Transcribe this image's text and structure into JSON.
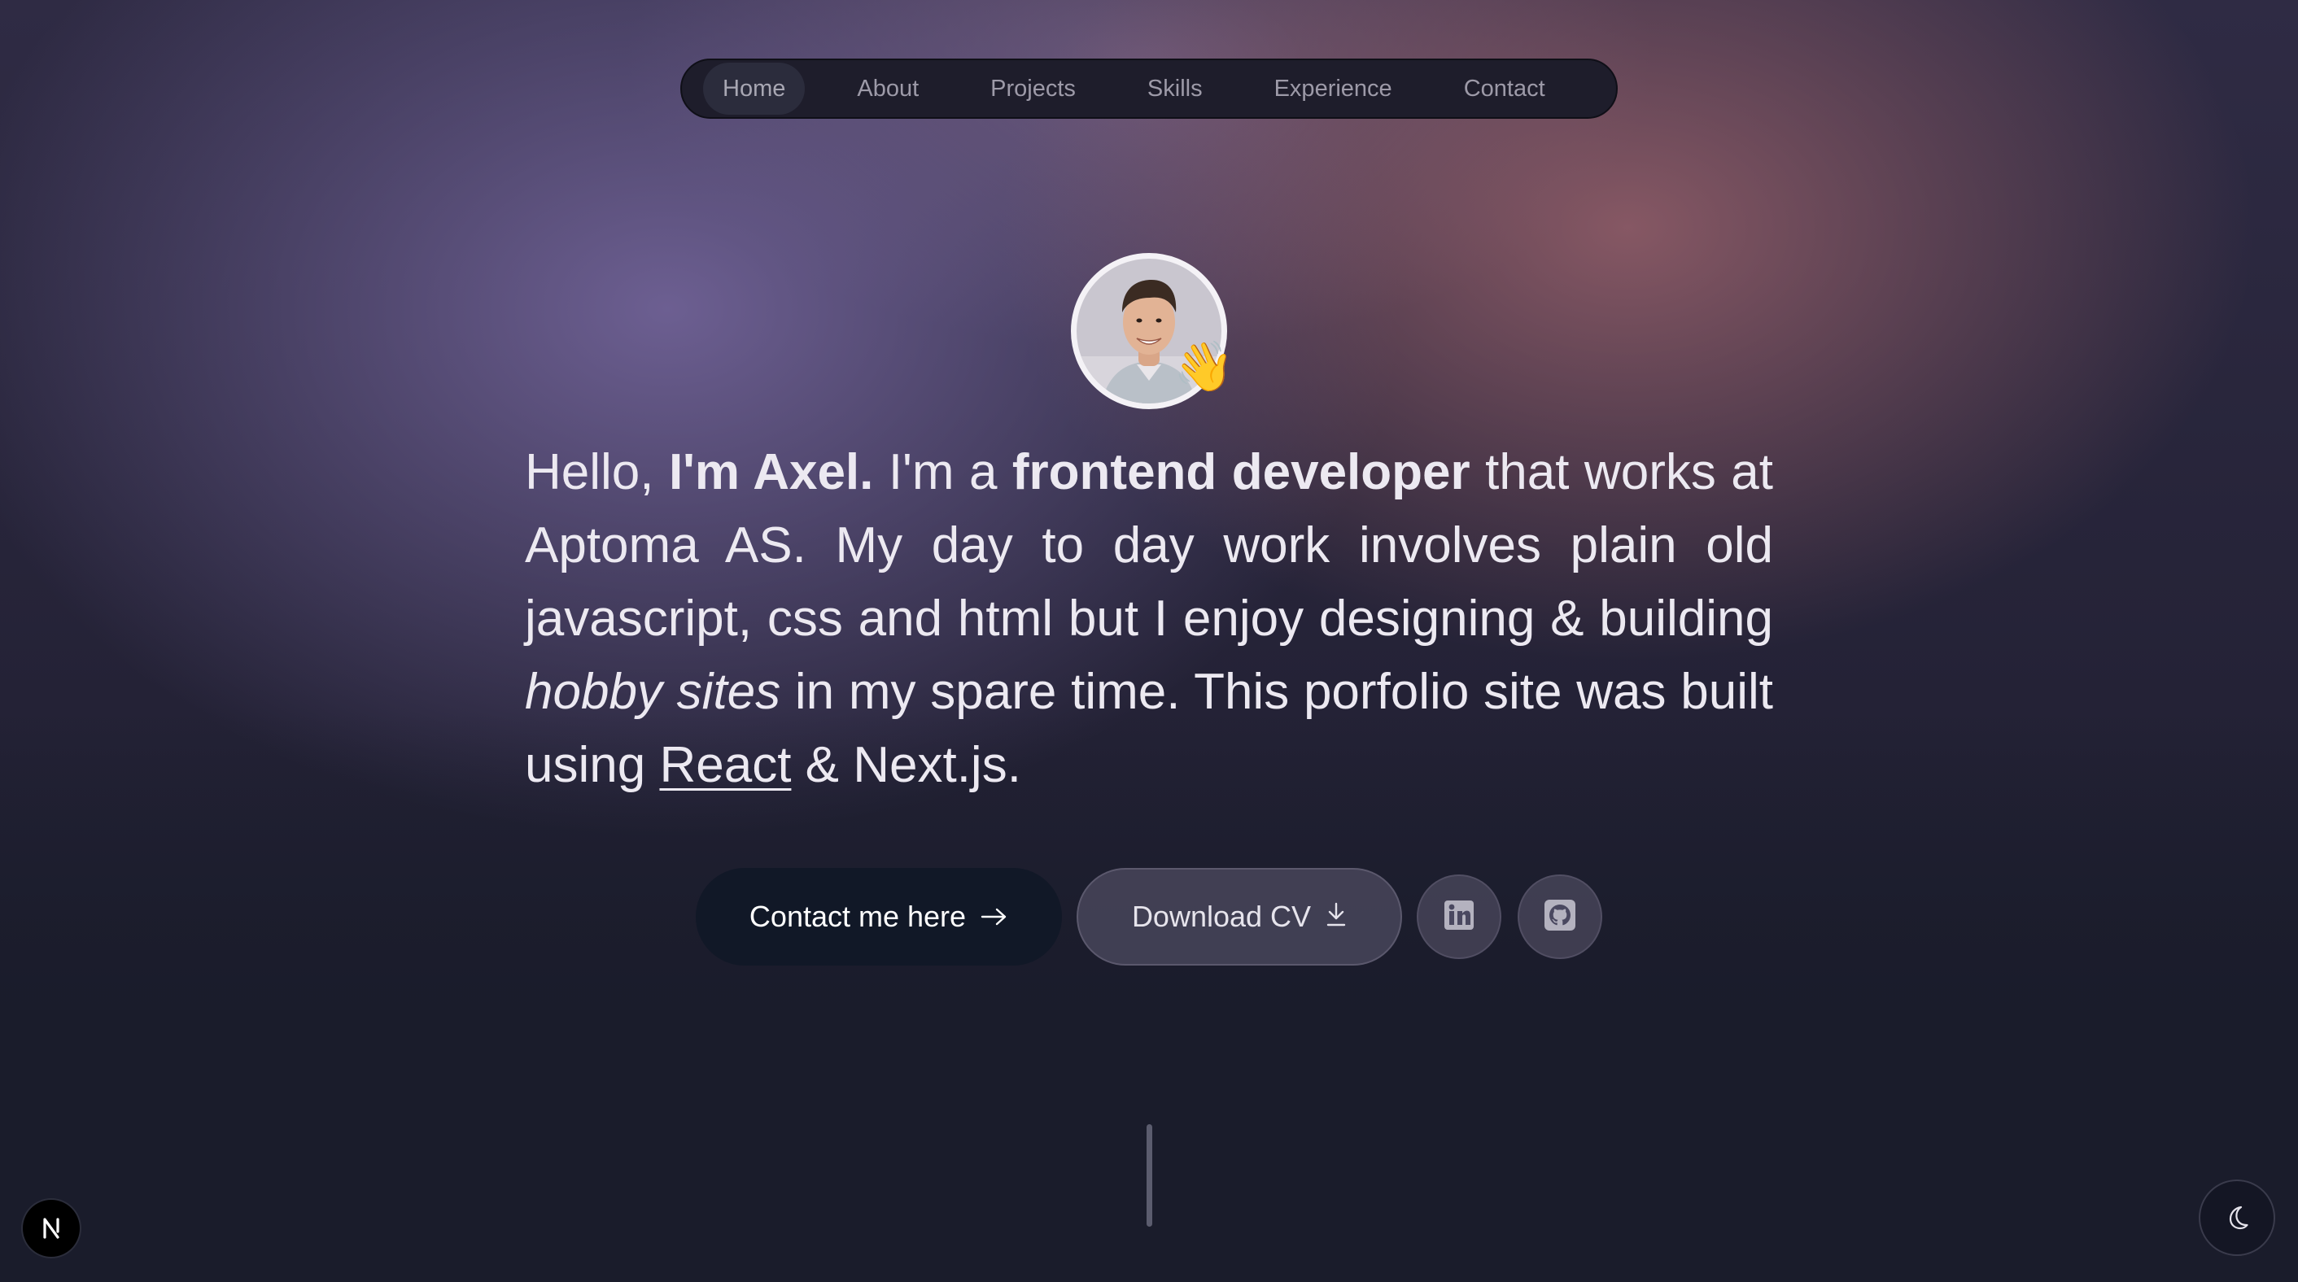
{
  "nav": {
    "items": [
      {
        "label": "Home",
        "active": true
      },
      {
        "label": "About",
        "active": false
      },
      {
        "label": "Projects",
        "active": false
      },
      {
        "label": "Skills",
        "active": false
      },
      {
        "label": "Experience",
        "active": false
      },
      {
        "label": "Contact",
        "active": false
      }
    ]
  },
  "hero": {
    "avatar_icon": "profile-photo",
    "wave_emoji": "👋",
    "intro": {
      "part1": "Hello, ",
      "name": "I'm Axel.",
      "part2": " I'm a ",
      "role": "frontend developer",
      "part3": " that works at Aptoma AS. My day to day work involves plain old javascript, css and html but I enjoy designing & building ",
      "hobby": "hobby sites",
      "part4": " in my spare time. This porfolio site was built using ",
      "react_link": "React",
      "part5": " & Next.js."
    }
  },
  "actions": {
    "contact_label": "Contact me here",
    "contact_icon": "arrow-right-icon",
    "cv_label": "Download CV",
    "cv_icon": "download-icon",
    "linkedin_icon": "linkedin-icon",
    "github_icon": "github-icon"
  },
  "footer": {
    "next_badge_letter": "N",
    "theme_icon": "moon-icon"
  },
  "colors": {
    "primary_button": "#111827",
    "text": "#ece9f1",
    "nav_background": "#1e1d2b"
  }
}
